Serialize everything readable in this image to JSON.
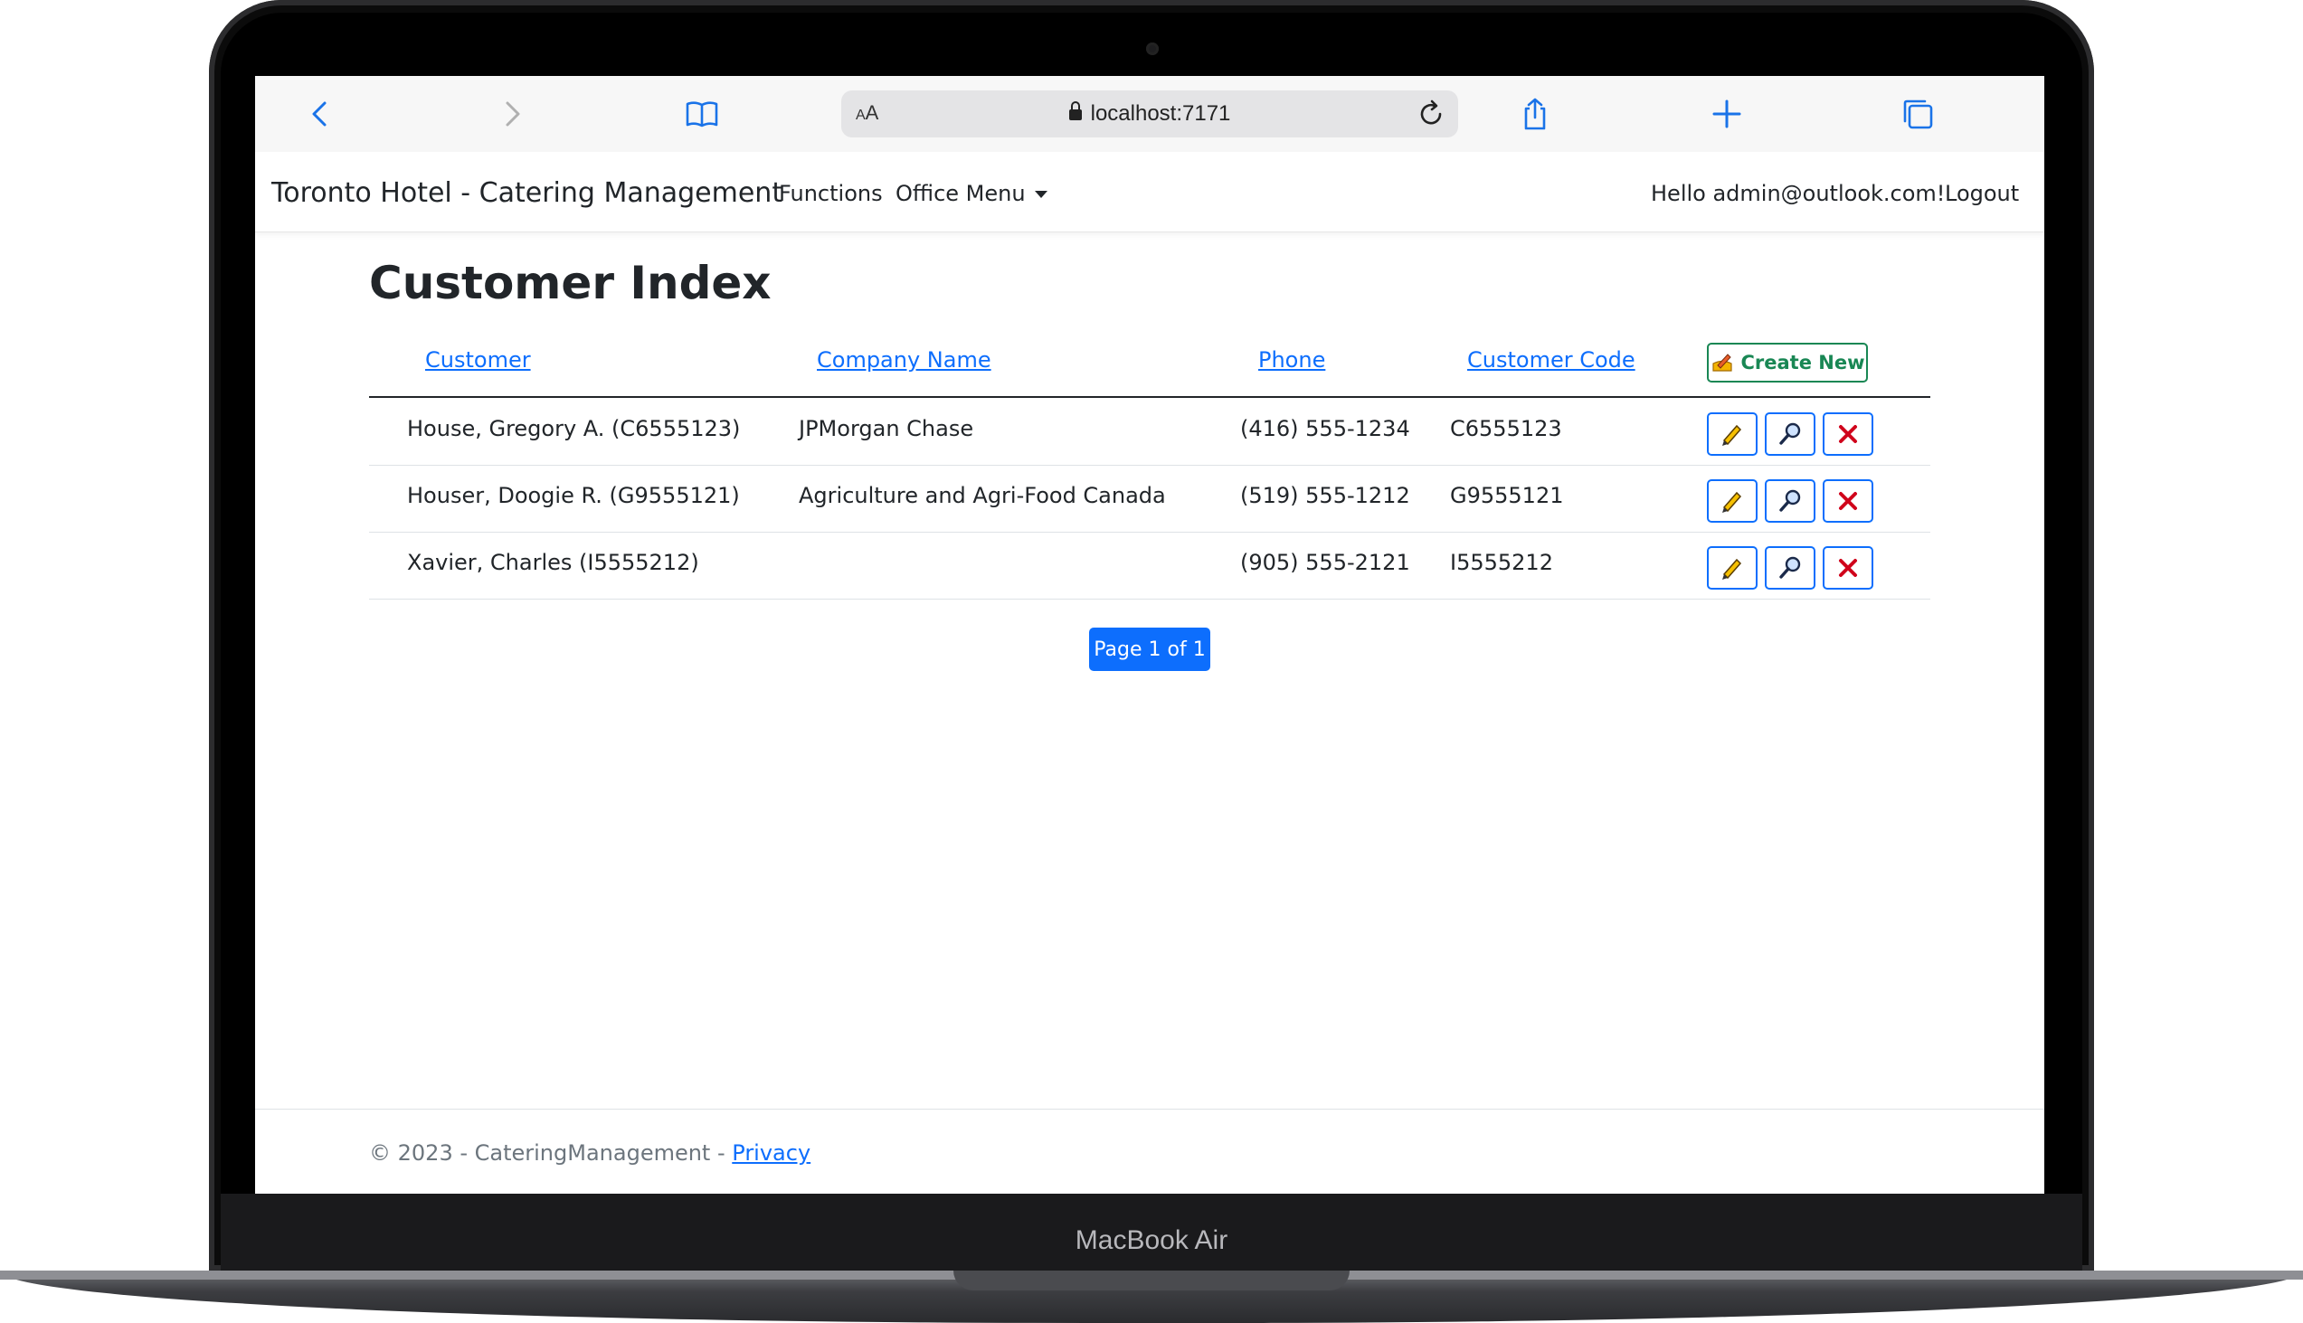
{
  "browser": {
    "url": "localhost:7171",
    "text_size_label": "AA"
  },
  "navbar": {
    "brand": "Toronto Hotel - Catering Management",
    "links": [
      "Functions",
      "Office Menu"
    ],
    "greeting": "Hello admin@outlook.com!",
    "logout": "Logout"
  },
  "page": {
    "title": "Customer Index",
    "columns": [
      "Customer",
      "Company Name",
      "Phone",
      "Customer Code"
    ],
    "create_label": "Create New",
    "rows": [
      {
        "customer": "House, Gregory A. (C6555123)",
        "company": "JPMorgan Chase",
        "phone": "(416) 555-1234",
        "code": "C6555123"
      },
      {
        "customer": "Houser, Doogie R. (G9555121)",
        "company": "Agriculture and Agri-Food Canada",
        "phone": "(519) 555-1212",
        "code": "G9555121"
      },
      {
        "customer": "Xavier, Charles (I5555212)",
        "company": "",
        "phone": "(905) 555-2121",
        "code": "I5555212"
      }
    ],
    "pager": "Page 1 of 1"
  },
  "footer": {
    "text": "© 2023 - CateringManagement - ",
    "privacy": "Privacy"
  },
  "device": {
    "label": "MacBook Air"
  },
  "colors": {
    "primary": "#0d6efd",
    "success": "#198754",
    "danger": "#dc3545"
  }
}
